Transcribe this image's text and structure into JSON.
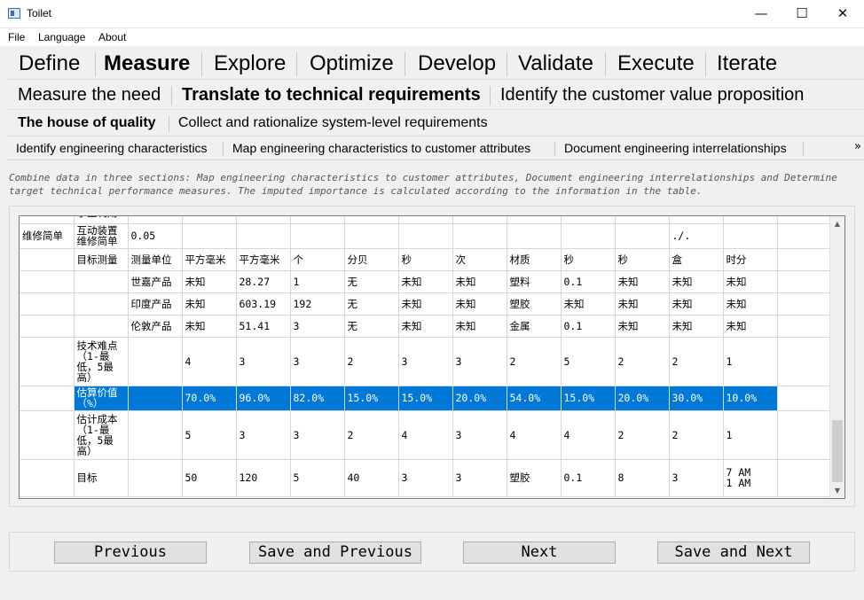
{
  "window": {
    "title": "Toilet",
    "minimize_glyph": "—",
    "maximize_glyph": "☐",
    "close_glyph": "✕"
  },
  "menu": [
    "File",
    "Language",
    "About"
  ],
  "phase_tabs": [
    "Define",
    "Measure",
    "Explore",
    "Optimize",
    "Develop",
    "Validate",
    "Execute",
    "Iterate"
  ],
  "step_tabs": [
    "Measure the need",
    "Translate to technical requirements",
    "Identify the customer value proposition"
  ],
  "substep_tabs": [
    "The house of quality",
    "Collect and rationalize system-level requirements"
  ],
  "task_tabs": [
    "Identify engineering characteristics",
    "Map engineering characteristics to customer attributes",
    "Document engineering interrelationships"
  ],
  "more_glyph": "»",
  "description": "Combine data in three sections: Map engineering characteristics to customer attributes, Document engineering interrelationships and Determine target technical performance measures. The imputed importance is calculated according to the information in the table.",
  "table": {
    "top_partial_row": [
      "",
      "乎重利用",
      "",
      "",
      "",
      "",
      "",
      "",
      "",
      "",
      "",
      "",
      "",
      "",
      ""
    ],
    "rows": [
      [
        "维修简单",
        "互动装置\n维修简单",
        "0.05",
        "",
        "",
        "",
        "",
        "",
        "",
        "",
        "",
        "",
        "./.",
        "",
        ""
      ],
      [
        "",
        "目标测量",
        "测量单位",
        "平方毫米",
        "平方毫米",
        "个",
        "分贝",
        "秒",
        "次",
        "材质",
        "秒",
        "秒",
        "盒",
        "时分",
        ""
      ],
      [
        "",
        "",
        "世嘉产品",
        "未知",
        "28.27",
        "1",
        "无",
        "未知",
        "未知",
        "塑料",
        "0.1",
        "未知",
        "未知",
        "未知",
        ""
      ],
      [
        "",
        "",
        "印度产品",
        "未知",
        "603.19",
        "192",
        "无",
        "未知",
        "未知",
        "塑胶",
        "未知",
        "未知",
        "未知",
        "未知",
        ""
      ],
      [
        "",
        "",
        "伦敦产品",
        "未知",
        "51.41",
        "3",
        "无",
        "未知",
        "未知",
        "金属",
        "0.1",
        "未知",
        "未知",
        "未知",
        ""
      ],
      [
        "",
        "技术难点\n（1-最\n低，5最\n高）",
        "",
        "4",
        "3",
        "3",
        "2",
        "3",
        "3",
        "2",
        "5",
        "2",
        "2",
        "1",
        ""
      ],
      [
        "",
        "估算价值\n（%）",
        "",
        "70.0%",
        "96.0%",
        "82.0%",
        "15.0%",
        "15.0%",
        "20.0%",
        "54.0%",
        "15.0%",
        "20.0%",
        "30.0%",
        "10.0%",
        ""
      ],
      [
        "",
        "估计成本\n（1-最\n低，5最\n高）",
        "",
        "5",
        "3",
        "3",
        "2",
        "4",
        "3",
        "4",
        "4",
        "2",
        "2",
        "1",
        ""
      ],
      [
        "",
        "目标",
        "",
        "50",
        "120",
        "5",
        "40",
        "3",
        "3",
        "塑胶",
        "0.1",
        "8",
        "3",
        "7 AM\n1 AM",
        ""
      ]
    ],
    "selected_row_index": 6
  },
  "scroll_up_glyph": "▲",
  "scroll_down_glyph": "▼",
  "buttons": {
    "previous": "Previous",
    "save_previous": "Save and Previous",
    "next": "Next",
    "save_next": "Save and Next"
  },
  "colors": {
    "selection": "#0078d7"
  }
}
